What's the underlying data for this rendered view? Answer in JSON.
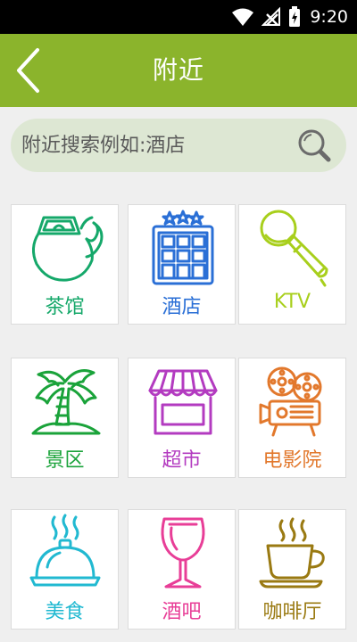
{
  "status": {
    "time": "9:20"
  },
  "header": {
    "title": "附近"
  },
  "search": {
    "placeholder": "附近搜索例如:酒店"
  },
  "categories": [
    {
      "label": "茶馆",
      "icon": "teapot-icon",
      "color": "#15a86a"
    },
    {
      "label": "酒店",
      "icon": "hotel-icon",
      "color": "#2a6fd6"
    },
    {
      "label": "KTV",
      "icon": "microphone-icon",
      "color": "#a8cf1c"
    },
    {
      "label": "景区",
      "icon": "palm-tree-icon",
      "color": "#1aa33a"
    },
    {
      "label": "超市",
      "icon": "supermarket-icon",
      "color": "#b33bc0"
    },
    {
      "label": "电影院",
      "icon": "film-projector-icon",
      "color": "#e2782c"
    },
    {
      "label": "美食",
      "icon": "food-cloche-icon",
      "color": "#21b9d1"
    },
    {
      "label": "酒吧",
      "icon": "wine-glass-icon",
      "color": "#e83e97"
    },
    {
      "label": "咖啡厅",
      "icon": "coffee-cup-icon",
      "color": "#9a7a12"
    }
  ]
}
